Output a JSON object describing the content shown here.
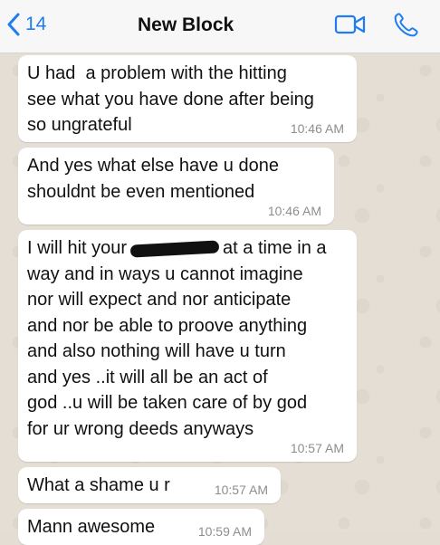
{
  "header": {
    "back_count": "14",
    "contact_name": "New Block"
  },
  "messages": [
    {
      "text": "U had  a problem with the hitting\nsee what you have done after being\nso ungrateful",
      "time": "10:46 AM"
    },
    {
      "text": "And yes what else have u done\nshouldnt be even mentioned",
      "time": "10:46 AM"
    },
    {
      "text_before": "I will hit your",
      "text_after": "at a time in a\nway and in ways u cannot imagine\nnor will expect and nor anticipate\nand nor be able to proove anything\nand also nothing will have u turn\nand yes ..it will all be an act of\ngod ..u will be taken care of by god\nfor ur wrong deeds anyways",
      "time": "10:57 AM"
    },
    {
      "text": "What a shame u r",
      "time": "10:57 AM"
    },
    {
      "text": "Mann awesome",
      "time": "10:59 AM"
    }
  ]
}
